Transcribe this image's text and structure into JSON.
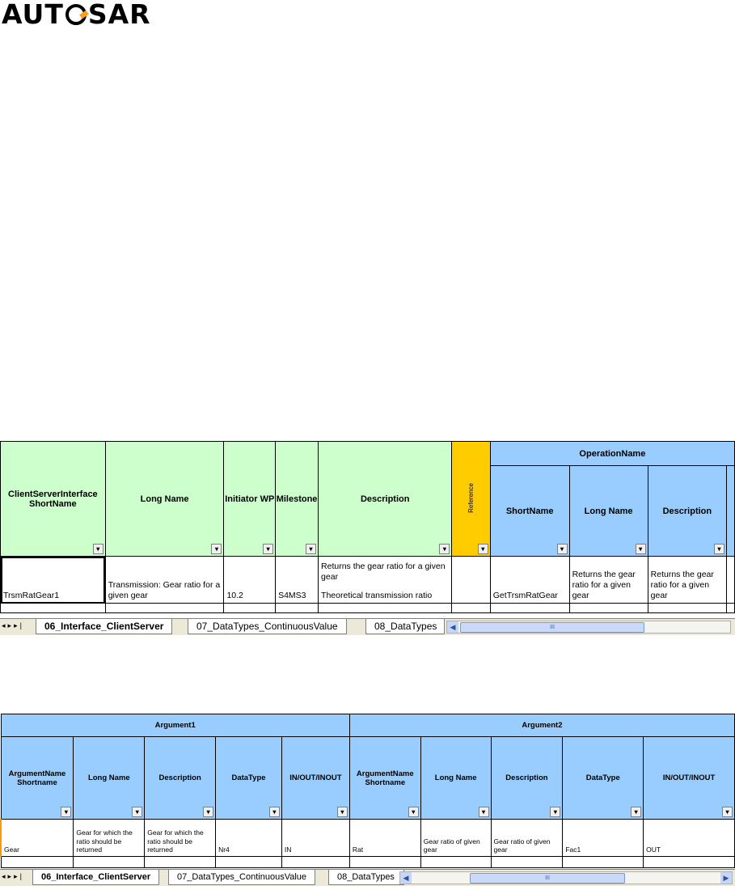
{
  "logo": {
    "text_before": "AUT",
    "text_after": "SAR"
  },
  "sheet1": {
    "headers": {
      "interface_short_name": "ClientServerInterface ShortName",
      "long_name": "Long Name",
      "initiator_wp": "Initiator WP",
      "milestone": "Milestone",
      "description": "Description",
      "reference": "Reference",
      "operation_name": "OperationName",
      "op_short_name": "ShortName",
      "op_long_name": "Long Name",
      "op_description": "Description"
    },
    "row": {
      "interface_short_name": "TrsmRatGear1",
      "long_name": "Transmission: Gear ratio for a given gear",
      "initiator_wp": "10.2",
      "milestone": "S4MS3",
      "description_line1": "Returns the gear ratio for a given gear",
      "description_line2": "Theoretical transmission ratio",
      "reference": "",
      "op_short_name": "GetTrsmRatGear",
      "op_long_name": "Returns the gear ratio for a given gear",
      "op_description": "Returns the gear ratio for a given gear"
    }
  },
  "sheet2": {
    "headers": {
      "argument1": "Argument1",
      "argument2": "Argument2",
      "arg_short_name": "ArgumentName Shortname",
      "long_name": "Long Name",
      "description": "Description",
      "data_type": "DataType",
      "direction": "IN/OUT/INOUT"
    },
    "row": {
      "arg1_short_name": "Gear",
      "arg1_long_name": "Gear for which the ratio should be returned",
      "arg1_description": "Gear for which the ratio should be returned",
      "arg1_data_type": "Nr4",
      "arg1_direction": "IN",
      "arg2_short_name": "Rat",
      "arg2_long_name": "Gear ratio of given gear",
      "arg2_description": "Gear ratio of given gear",
      "arg2_data_type": "Fac1",
      "arg2_direction": "OUT"
    }
  },
  "sheet_tabs": [
    "06_Interface_ClientServer",
    "07_DataTypes_ContinuousValue",
    "08_DataTypes"
  ],
  "icons": [
    "filter-dropdown-icon",
    "first-sheet-icon",
    "previous-sheet-icon",
    "next-sheet-icon",
    "last-sheet-icon",
    "scroll-left-icon",
    "scroll-right-icon"
  ]
}
